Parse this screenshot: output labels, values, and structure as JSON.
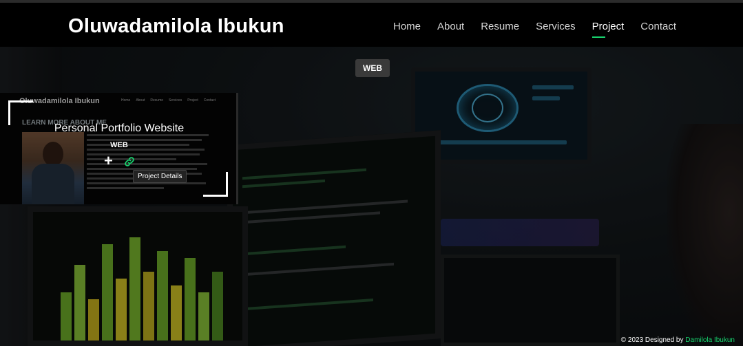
{
  "header": {
    "brand": "Oluwadamilola Ibukun",
    "nav": [
      "Home",
      "About",
      "Resume",
      "Services",
      "Project",
      "Contact"
    ],
    "active": "Project"
  },
  "filter": {
    "label": "WEB"
  },
  "card": {
    "title": "Personal Portfolio Website",
    "category": "WEB",
    "details_tooltip": "Project Details",
    "thumb": {
      "brand": "Oluwadamilola Ibukun",
      "nav": [
        "Home",
        "About",
        "Resume",
        "Services",
        "Project",
        "Contact"
      ],
      "heading": "LEARN MORE ABOUT ME"
    }
  },
  "footer": {
    "prefix": "© 2023 Designed by ",
    "author": "Damilola Ibukun"
  },
  "colors": {
    "accent": "#18d26e",
    "header_bg": "#000000"
  }
}
